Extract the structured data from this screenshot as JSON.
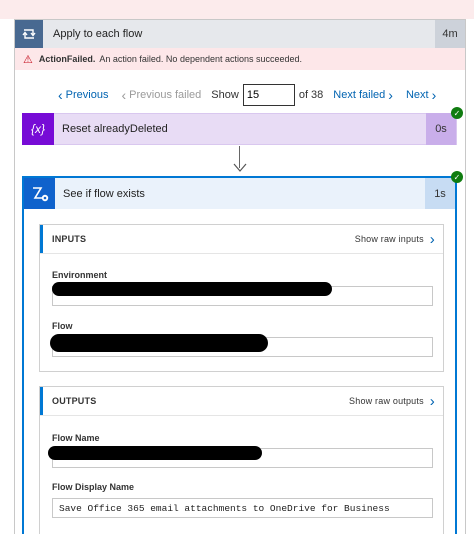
{
  "loop": {
    "title": "Apply to each flow",
    "duration": "4m",
    "icon": "loop-icon"
  },
  "error": {
    "icon": "warning-icon",
    "label": "ActionFailed.",
    "message": "An action failed. No dependent actions succeeded."
  },
  "pager": {
    "previous": "Previous",
    "previous_failed": "Previous failed",
    "show_label": "Show",
    "current": "15",
    "of_label": "of 38",
    "next_failed": "Next failed",
    "next": "Next"
  },
  "variable_action": {
    "icon_text": "{x}",
    "title": "Reset alreadyDeleted",
    "duration": "0s",
    "status": "succeeded"
  },
  "flow_action": {
    "title": "See if flow exists",
    "duration": "1s",
    "status": "succeeded",
    "icon": "flow-management-icon"
  },
  "inputs": {
    "header": "INPUTS",
    "show_raw": "Show raw inputs",
    "environment_label": "Environment",
    "flow_label": "Flow"
  },
  "outputs": {
    "header": "OUTPUTS",
    "show_raw": "Show raw outputs",
    "flow_name_label": "Flow Name",
    "flow_display_name_label": "Flow Display Name",
    "flow_display_name_value": "Save Office 365 email attachments to OneDrive for Business"
  },
  "colors": {
    "accent": "#0078d4",
    "variable": "#770bd6",
    "success": "#107c10",
    "error_bg": "#fde7e9"
  }
}
